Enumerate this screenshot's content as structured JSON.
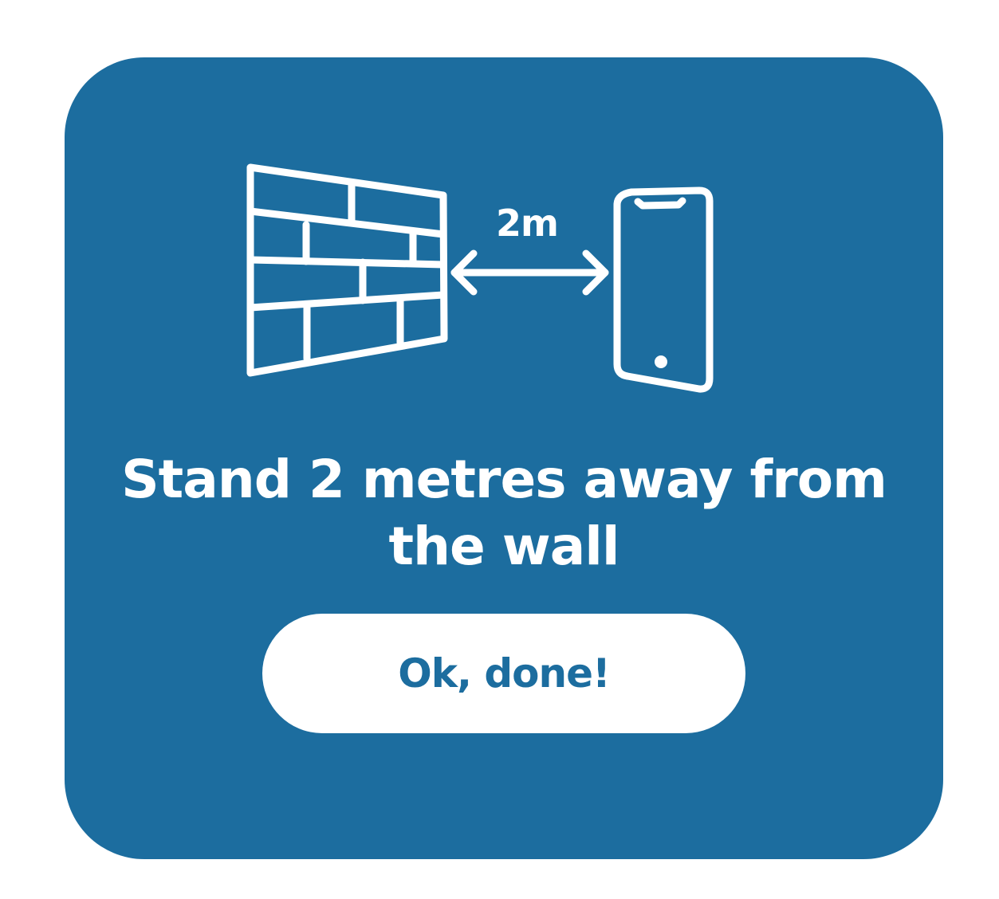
{
  "illustration": {
    "distance_label": "2m",
    "wall_icon": "brick-wall-icon",
    "arrow_icon": "double-arrow-icon",
    "phone_icon": "smartphone-icon"
  },
  "headline": "Stand 2 metres away from the wall",
  "cta": {
    "label": "Ok, done!"
  },
  "colors": {
    "card_background": "#1c6d9f",
    "foreground": "#ffffff",
    "button_text": "#1c6d9f"
  }
}
